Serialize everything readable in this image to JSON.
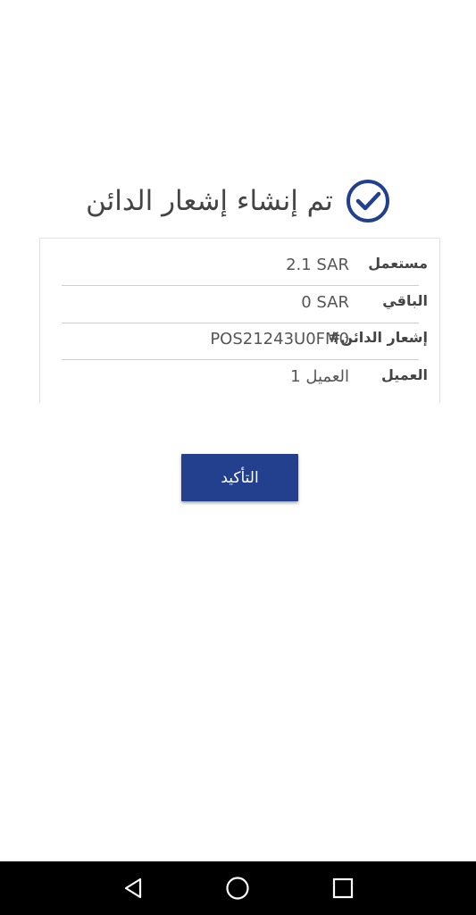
{
  "header": {
    "title": "تم إنشاء إشعار الدائن",
    "icon": "check-circle-icon",
    "accent_color": "#23408e"
  },
  "details": [
    {
      "label": "مستعمل",
      "value": "2.1 SAR"
    },
    {
      "label": "الباقي",
      "value": "0 SAR"
    },
    {
      "label": "إشعار الدائن#",
      "value": "POS21243U0FM0"
    },
    {
      "label": "العميل",
      "value": "العميل 1"
    }
  ],
  "confirm_button": {
    "label": "التأكيد",
    "color": "#23408e"
  },
  "system_nav": {
    "back": "back-triangle-icon",
    "home": "home-circle-icon",
    "recents": "recents-square-icon"
  }
}
